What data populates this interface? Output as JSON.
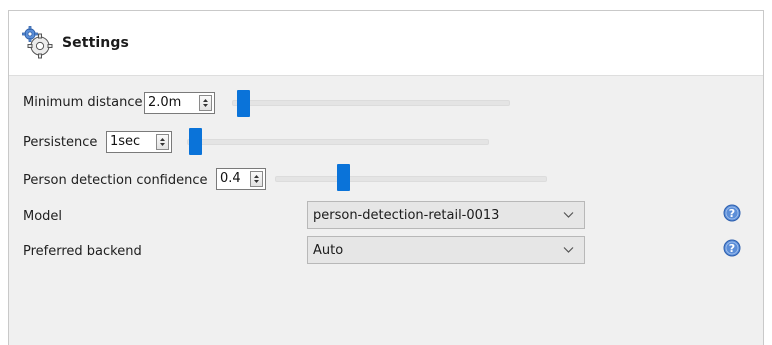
{
  "header": {
    "title": "Settings",
    "icon": "gears-icon"
  },
  "settings": {
    "min_distance": {
      "label": "Minimum distance",
      "value": "2.0m",
      "slider_fraction": 0.03
    },
    "persistence": {
      "label": "Persistence",
      "value": "1sec",
      "slider_fraction": 0.02
    },
    "confidence": {
      "label": "Person detection confidence",
      "value": "0.4",
      "slider_fraction": 0.25
    },
    "model": {
      "label": "Model",
      "selected": "person-detection-retail-0013"
    },
    "backend": {
      "label": "Preferred backend",
      "selected": "Auto"
    }
  },
  "colors": {
    "accent": "#0a73d9",
    "help": "#4a7fd0"
  }
}
